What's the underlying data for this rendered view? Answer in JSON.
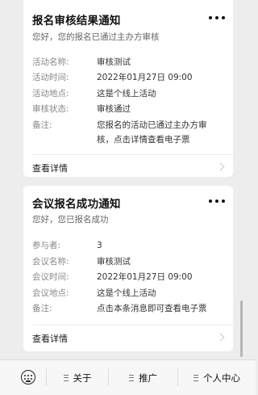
{
  "cards": [
    {
      "title": "报名审核结果通知",
      "subtitle": "您好，您的报名已通过主办方审核",
      "fields": [
        {
          "label": "活动名称:",
          "value": "审核测试"
        },
        {
          "label": "活动时间:",
          "value": "2022年01月27日 09:00"
        },
        {
          "label": "活动地点:",
          "value": "这是个线上活动"
        },
        {
          "label": "审核状态:",
          "value": "审核通过"
        },
        {
          "label": "备注:",
          "value": "您报名的活动已通过主办方审核，点击详情查看电子票"
        }
      ],
      "detail_label": "查看详情"
    },
    {
      "title": "会议报名成功通知",
      "subtitle": "您好，您已报名成功",
      "fields": [
        {
          "label": "参与者:",
          "value": "3"
        },
        {
          "label": "会议名称:",
          "value": "审核测试"
        },
        {
          "label": "会议时间:",
          "value": "2022年01月27日 09:00"
        },
        {
          "label": "会议地点:",
          "value": "这是个线上活动"
        },
        {
          "label": "备注:",
          "value": "点击本条消息即可查看电子票"
        }
      ],
      "detail_label": "查看详情"
    }
  ],
  "bottom_menu": {
    "items": [
      {
        "label": "关于"
      },
      {
        "label": "推广"
      },
      {
        "label": "个人中心"
      }
    ]
  },
  "icons": {
    "more": "more-icon",
    "chevron": "chevron-right-icon",
    "keyboard": "keyboard-icon",
    "menu": "list-icon"
  }
}
